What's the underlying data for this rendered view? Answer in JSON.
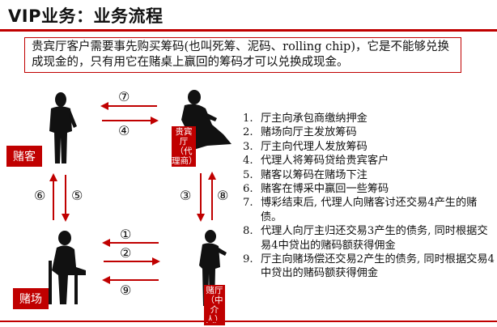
{
  "title": "VIP业务：业务流程",
  "note": "贵宾厅客户需要事先购买筹码(也叫死筹、泥码、rolling chip)，它是不能够兑换成现金的，只有用它在赌桌上赢回的筹码才可以兑换成现金。",
  "labels": {
    "gambler": "赌客",
    "casino": "赌场",
    "hall": "贵宾厅（代理商）",
    "hall_lines": [
      "贵宾",
      "厅",
      "（代",
      "理商）"
    ],
    "agent_lines": [
      "赌厅",
      "（中",
      "介人）"
    ]
  },
  "arrow_numbers": [
    "⑦",
    "④",
    "⑥",
    "⑤",
    "③",
    "⑧",
    "①",
    "②",
    "⑨"
  ],
  "steps": [
    {
      "n": "1.",
      "text": "厅主向承包商缴纳押金"
    },
    {
      "n": "2.",
      "text": "赌场向厅主发放筹码"
    },
    {
      "n": "3.",
      "text": "厅主向代理人发放筹码"
    },
    {
      "n": "4.",
      "text": "代理人将筹码贷给贵宾客户"
    },
    {
      "n": "5.",
      "text": "赌客以筹码在赌场下注"
    },
    {
      "n": "6.",
      "text": "赌客在博采中赢回一些筹码"
    },
    {
      "n": "7.",
      "text": "博彩结束后, 代理人向赌客讨还交易4产生的赌债。"
    },
    {
      "n": "8.",
      "text": "代理人向厅主归还交易3产生的债务, 同时根据交易4中贷出的赌码额获得佣金"
    },
    {
      "n": "9.",
      "text": "厅主向赌场偿还交易2产生的债务, 同时根据交易4中贷出的赌码额获得佣金"
    }
  ],
  "colors": {
    "accent": "#c00000",
    "figure": "#111111"
  }
}
